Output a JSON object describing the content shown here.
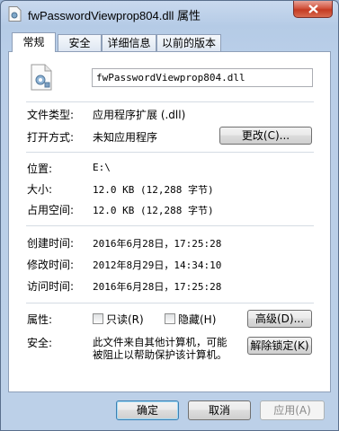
{
  "window": {
    "title": "fwPasswordViewprop804.dll 属性"
  },
  "tabs": [
    {
      "label": "常规",
      "active": true
    },
    {
      "label": "安全",
      "active": false
    },
    {
      "label": "详细信息",
      "active": false
    },
    {
      "label": "以前的版本",
      "active": false
    }
  ],
  "general": {
    "filename": "fwPasswordViewprop804.dll",
    "type_label": "文件类型:",
    "type_value": "应用程序扩展 (.dll)",
    "opens_label": "打开方式:",
    "opens_value": "未知应用程序",
    "change_button": "更改(C)...",
    "location_label": "位置:",
    "location_value": "E:\\",
    "size_label": "大小:",
    "size_value": "12.0 KB (12,288 字节)",
    "disk_label": "占用空间:",
    "disk_value": "12.0 KB (12,288 字节)",
    "created_label": "创建时间:",
    "created_value": "2016年6月28日，17:25:28",
    "modified_label": "修改时间:",
    "modified_value": "2012年8月29日，14:34:10",
    "accessed_label": "访问时间:",
    "accessed_value": "2016年6月28日，17:25:28",
    "attributes_label": "属性:",
    "readonly_label": "只读(R)",
    "readonly_checked": false,
    "hidden_label": "隐藏(H)",
    "hidden_checked": false,
    "advanced_button": "高级(D)...",
    "security_label": "安全:",
    "security_text_line1": "此文件来自其他计算机，可能",
    "security_text_line2": "被阻止以帮助保护该计算机。",
    "unblock_button": "解除锁定(K)"
  },
  "footer": {
    "ok_button": "确定",
    "cancel_button": "取消",
    "apply_button": "应用(A)"
  },
  "colors": {
    "accent": "#3c7fb1",
    "close": "#c43a22"
  }
}
